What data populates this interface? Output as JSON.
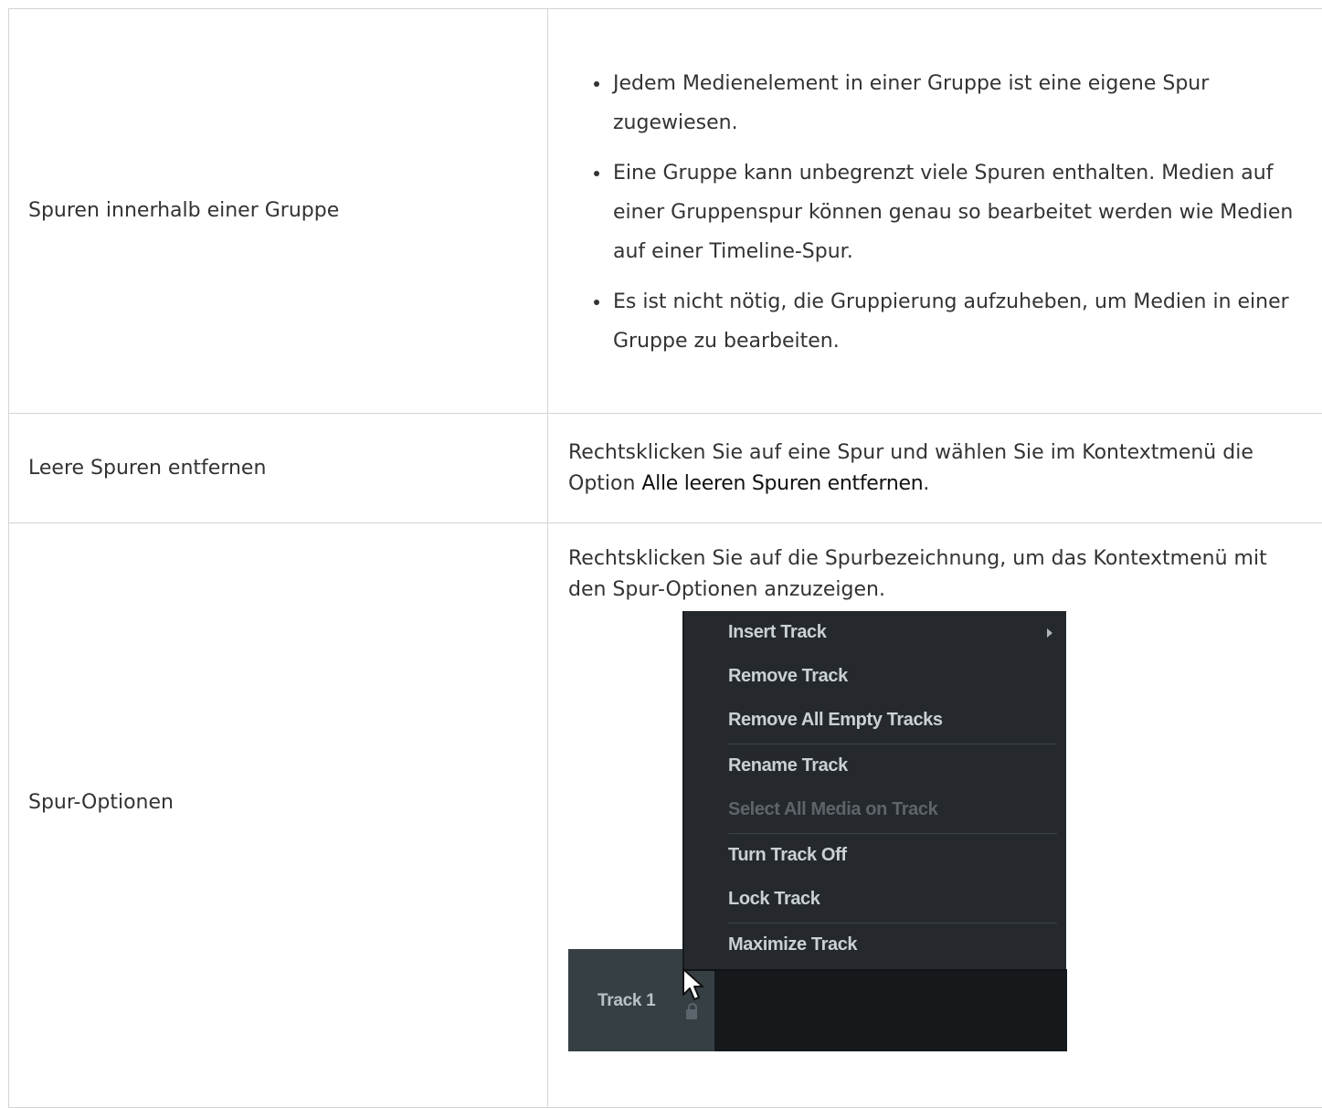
{
  "rows": [
    {
      "label": "Spuren innerhalb einer Gruppe",
      "bullets": [
        "Jedem Medienelement in einer Gruppe ist eine eigene Spur zugewiesen.",
        "Eine Gruppe kann unbegrenzt viele Spuren enthalten. Medien auf einer Gruppenspur können genau so bearbeitet werden wie Medien auf einer Timeline-Spur.",
        "Es ist nicht nötig, die Gruppierung aufzuheben, um Medien in einer Gruppe zu bearbeiten."
      ]
    },
    {
      "label": "Leere Spuren entfernen",
      "text_before": "Rechtsklicken Sie auf eine Spur und wählen Sie im Kontextmenü die Option ",
      "text_bold": "Alle leeren Spuren entfernen",
      "text_after": "."
    },
    {
      "label": "Spur-Optionen",
      "text": "Rechtsklicken Sie auf die Spurbezeichnung, um das Kontextmenü mit den Spur-Optionen anzuzeigen."
    }
  ],
  "screenshot": {
    "track_label": "Track 1",
    "menu_items": [
      "Insert Track",
      "Remove Track",
      "Remove All Empty Tracks",
      "Rename Track",
      "Select All Media on Track",
      "Turn Track Off",
      "Lock Track",
      "Maximize Track"
    ],
    "disabled_item": "Select All Media on Track",
    "colors": {
      "menu_bg": "#25292d",
      "menu_text": "#c9d1d5",
      "menu_text_disabled": "#5d656a",
      "track_header_bg": "#353f44",
      "timeline_bg": "#15191c"
    },
    "icons": [
      "submenu-arrow-icon",
      "lock-icon",
      "mouse-cursor-icon"
    ]
  }
}
